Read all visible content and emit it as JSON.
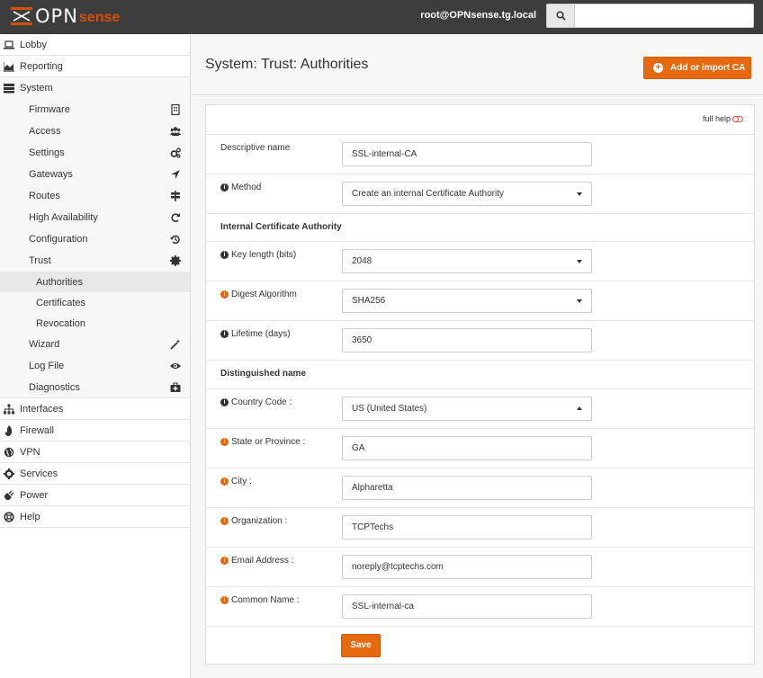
{
  "header": {
    "logo_opn": "OPN",
    "logo_sense": "sense",
    "user": "root@OPNsense.tg.local",
    "search_placeholder": ""
  },
  "sidebar": {
    "top_items": [
      {
        "label": "Lobby",
        "icon": "laptop-icon"
      },
      {
        "label": "Reporting",
        "icon": "area-chart-icon"
      },
      {
        "label": "System",
        "icon": "server-icon"
      }
    ],
    "system_items": [
      {
        "label": "Firmware",
        "icon": "building-icon"
      },
      {
        "label": "Access",
        "icon": "users-icon"
      },
      {
        "label": "Settings",
        "icon": "cogs-icon"
      },
      {
        "label": "Gateways",
        "icon": "location-arrow-icon"
      },
      {
        "label": "Routes",
        "icon": "map-signs-icon"
      },
      {
        "label": "High Availability",
        "icon": "refresh-icon"
      },
      {
        "label": "Configuration",
        "icon": "history-icon"
      },
      {
        "label": "Trust",
        "icon": "certificate-icon"
      }
    ],
    "trust_items": [
      {
        "label": "Authorities",
        "active": true
      },
      {
        "label": "Certificates"
      },
      {
        "label": "Revocation"
      }
    ],
    "system_items_after": [
      {
        "label": "Wizard",
        "icon": "magic-icon"
      },
      {
        "label": "Log File",
        "icon": "eye-icon"
      },
      {
        "label": "Diagnostics",
        "icon": "medkit-icon"
      }
    ],
    "bottom_items": [
      {
        "label": "Interfaces",
        "icon": "sitemap-icon"
      },
      {
        "label": "Firewall",
        "icon": "fire-icon"
      },
      {
        "label": "VPN",
        "icon": "globe-icon"
      },
      {
        "label": "Services",
        "icon": "cog-icon"
      },
      {
        "label": "Power",
        "icon": "plug-icon"
      },
      {
        "label": "Help",
        "icon": "life-ring-icon"
      }
    ]
  },
  "page": {
    "title": "System: Trust: Authorities",
    "add_button": "Add or import CA",
    "full_help": "full help"
  },
  "form": {
    "descriptive_name": {
      "label": "Descriptive name",
      "value": "SSL-internal-CA"
    },
    "method": {
      "label": "Method",
      "value": "Create an internal Certificate Authority"
    },
    "section_internal": "Internal Certificate Authority",
    "key_length": {
      "label": "Key length (bits)",
      "value": "2048"
    },
    "digest": {
      "label": "Digest Algorithm",
      "value": "SHA256"
    },
    "lifetime": {
      "label": "Lifetime (days)",
      "value": "3650"
    },
    "section_dn": "Distinguished name",
    "country": {
      "label": "Country Code :",
      "value": "US (United States)"
    },
    "state": {
      "label": "State or Province :",
      "value": "GA"
    },
    "city": {
      "label": "City :",
      "value": "Alpharetta"
    },
    "organization": {
      "label": "Organization :",
      "value": "TCPTechs"
    },
    "email": {
      "label": "Email Address :",
      "value": "noreply@tcptechs.com"
    },
    "common_name": {
      "label": "Common Name :",
      "value": "SSL-internal-ca"
    },
    "save": "Save"
  },
  "colors": {
    "accent": "#e6680f",
    "topbar": "#3d3d3d",
    "info_orange": "#e6680f"
  }
}
